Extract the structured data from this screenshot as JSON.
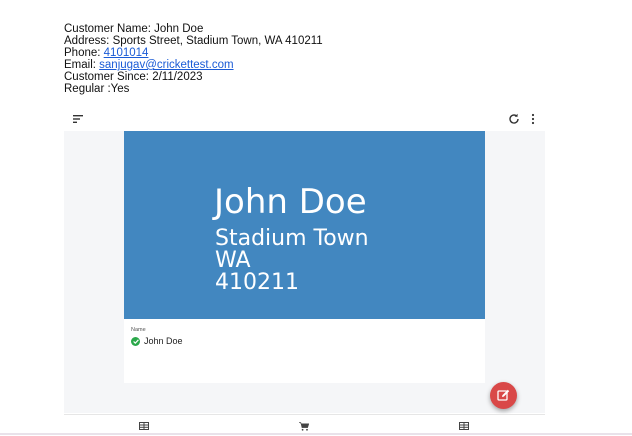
{
  "customer": {
    "name_line": "Customer Name: John Doe",
    "address_line": "Address: Sports Street, Stadium Town, WA 410211",
    "phone_label": "Phone: ",
    "phone": "4101014",
    "email_label": "Email: ",
    "email": "sanjugav@crickettest.com",
    "since_line": "Customer Since: 2/11/2023",
    "regular_line": "Regular :Yes"
  },
  "card": {
    "name": "John Doe",
    "address_lines": [
      "Stadium Town",
      "WA",
      "410211"
    ],
    "field_label": "Name",
    "field_value": "John Doe"
  },
  "icons": {
    "toolbar": [
      "sort-icon",
      "refresh-icon",
      "more-vert-icon"
    ],
    "fab": "edit-icon",
    "nav": [
      "table-icon",
      "cart-icon",
      "table-icon"
    ]
  },
  "colors": {
    "banner": "#4287c0",
    "fab": "#d94848",
    "check": "#2aa84a",
    "link": "#1a5bd6"
  }
}
